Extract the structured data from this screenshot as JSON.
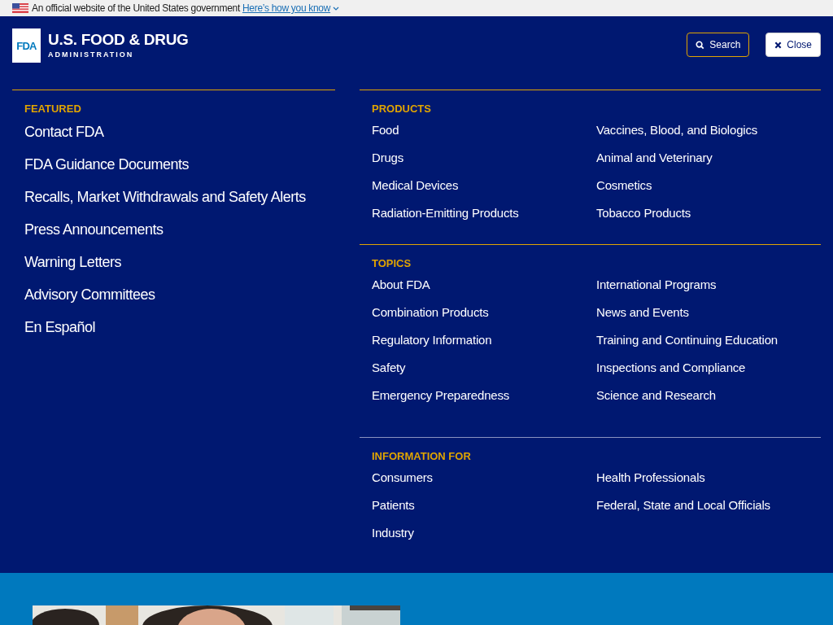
{
  "gov_banner": {
    "text": "An official website of the United States government",
    "link": "Here’s how you know"
  },
  "header": {
    "logo_mark": "FDA",
    "logo_title": "U.S. FOOD & DRUG",
    "logo_subtitle": "ADMINISTRATION",
    "buttons": [
      {
        "kind": "search",
        "label": "Search"
      },
      {
        "kind": "close",
        "label": "Close"
      }
    ]
  },
  "featured": {
    "heading": "FEATURED",
    "links": [
      "Contact FDA",
      "FDA Guidance Documents",
      "Recalls, Market Withdrawals and Safety Alerts",
      "Press Announcements",
      "Warning Letters",
      "Advisory Committees",
      "En Español"
    ]
  },
  "sections": [
    {
      "heading": "PRODUCTS",
      "links": [
        "Food",
        "Drugs",
        "Medical Devices",
        "Radiation-Emitting Products",
        "Vaccines, Blood, and Biologics",
        "Animal and Veterinary",
        "Cosmetics",
        "Tobacco Products"
      ]
    },
    {
      "heading": "TOPICS",
      "links": [
        "About FDA",
        "Combination Products",
        "Regulatory Information",
        "Safety",
        "Emergency Preparedness",
        "International Programs",
        "News and Events",
        "Training and Continuing Education",
        "Inspections and Compliance",
        "Science and Research"
      ]
    },
    {
      "heading": "INFORMATION FOR",
      "links": [
        "Consumers",
        "Patients",
        "Industry",
        "Health Professionals",
        "Federal, State and Local Officials"
      ]
    }
  ]
}
